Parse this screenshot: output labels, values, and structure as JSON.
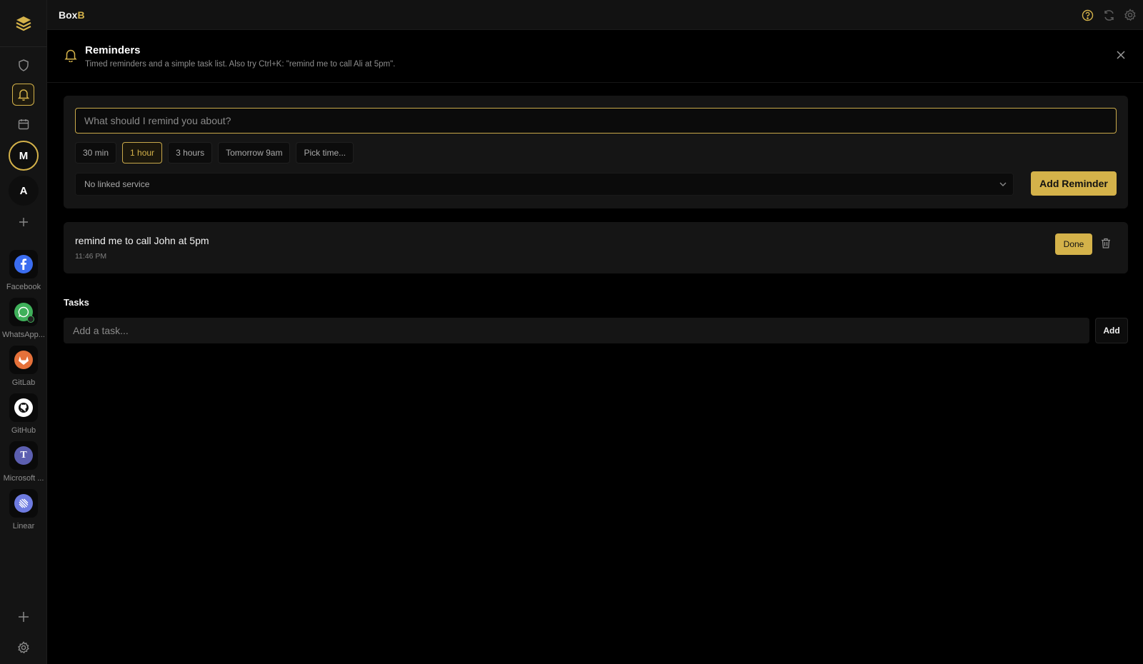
{
  "app": {
    "brand_main": "Box",
    "brand_accent": "B",
    "accent_color": "#d4b24a"
  },
  "titlebar": {
    "icons": [
      "help-icon",
      "refresh-icon",
      "settings-icon"
    ]
  },
  "sidebar": {
    "nav": [
      "shield-icon",
      "bell-icon",
      "calendar-icon"
    ],
    "workspaces": [
      {
        "initial": "M"
      },
      {
        "initial": "A"
      }
    ],
    "services": [
      {
        "label": "Facebook",
        "color": "#3b6df0"
      },
      {
        "label": "WhatsApp...",
        "color": "#3fb05a"
      },
      {
        "label": "GitLab",
        "color": "#e5713a"
      },
      {
        "label": "GitHub",
        "color": "#ffffff"
      },
      {
        "label": "Microsoft ...",
        "color": "#5c5fb0",
        "glyph": "T"
      },
      {
        "label": "Linear",
        "color": "#6e7be0"
      }
    ]
  },
  "panel": {
    "title": "Reminders",
    "subtitle": "Timed reminders and a simple task list. Also try Ctrl+K: \"remind me to call Ali at 5pm\"."
  },
  "composer": {
    "placeholder": "What should I remind you about?",
    "chips": [
      "30 min",
      "1 hour",
      "3 hours",
      "Tomorrow 9am",
      "Pick time..."
    ],
    "active_chip": "1 hour",
    "linked_service": "No linked service",
    "add_label": "Add Reminder"
  },
  "reminders": [
    {
      "text": "remind me to call John at 5pm",
      "time": "11:46 PM",
      "done_label": "Done"
    }
  ],
  "tasks": {
    "title": "Tasks",
    "placeholder": "Add a task...",
    "add_label": "Add"
  }
}
